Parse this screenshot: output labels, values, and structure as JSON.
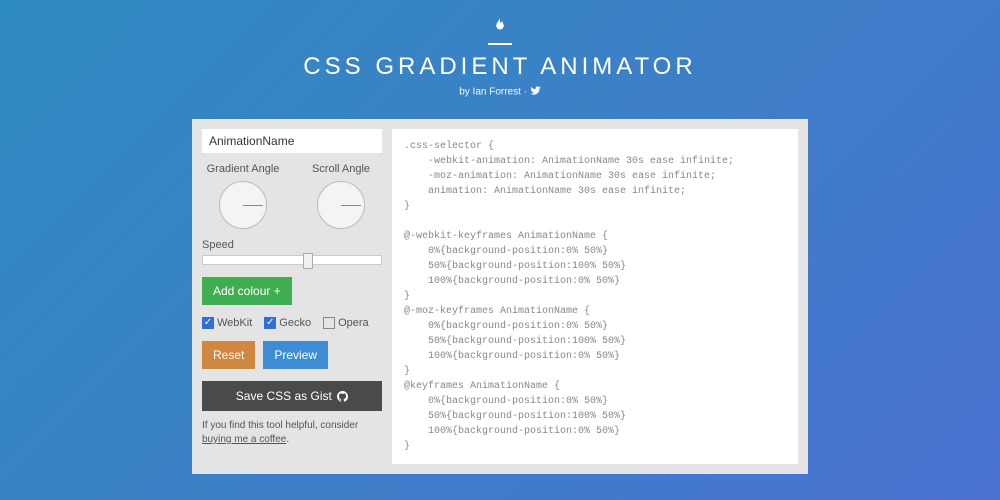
{
  "header": {
    "title": "CSS GRADIENT ANIMATOR",
    "byline_prefix": "by ",
    "author": "Ian Forrest",
    "separator": " · "
  },
  "controls": {
    "animation_name_value": "AnimationName",
    "gradient_angle_label": "Gradient Angle",
    "scroll_angle_label": "Scroll Angle",
    "speed_label": "Speed",
    "speed_percent": 56,
    "add_colour_label": "Add colour +",
    "checkboxes": [
      {
        "label": "WebKit",
        "checked": true
      },
      {
        "label": "Gecko",
        "checked": true
      },
      {
        "label": "Opera",
        "checked": false
      }
    ],
    "reset_label": "Reset",
    "preview_label": "Preview",
    "save_gist_label": "Save CSS as Gist",
    "helpful_text": "If you find this tool helpful, consider ",
    "helpful_link": "buying me a coffee",
    "helpful_suffix": "."
  },
  "code": ".css-selector {\n    -webkit-animation: AnimationName 30s ease infinite;\n    -moz-animation: AnimationName 30s ease infinite;\n    animation: AnimationName 30s ease infinite;\n}\n\n@-webkit-keyframes AnimationName {\n    0%{background-position:0% 50%}\n    50%{background-position:100% 50%}\n    100%{background-position:0% 50%}\n}\n@-moz-keyframes AnimationName {\n    0%{background-position:0% 50%}\n    50%{background-position:100% 50%}\n    100%{background-position:0% 50%}\n}\n@keyframes AnimationName {\n    0%{background-position:0% 50%}\n    50%{background-position:100% 50%}\n    100%{background-position:0% 50%}\n}"
}
